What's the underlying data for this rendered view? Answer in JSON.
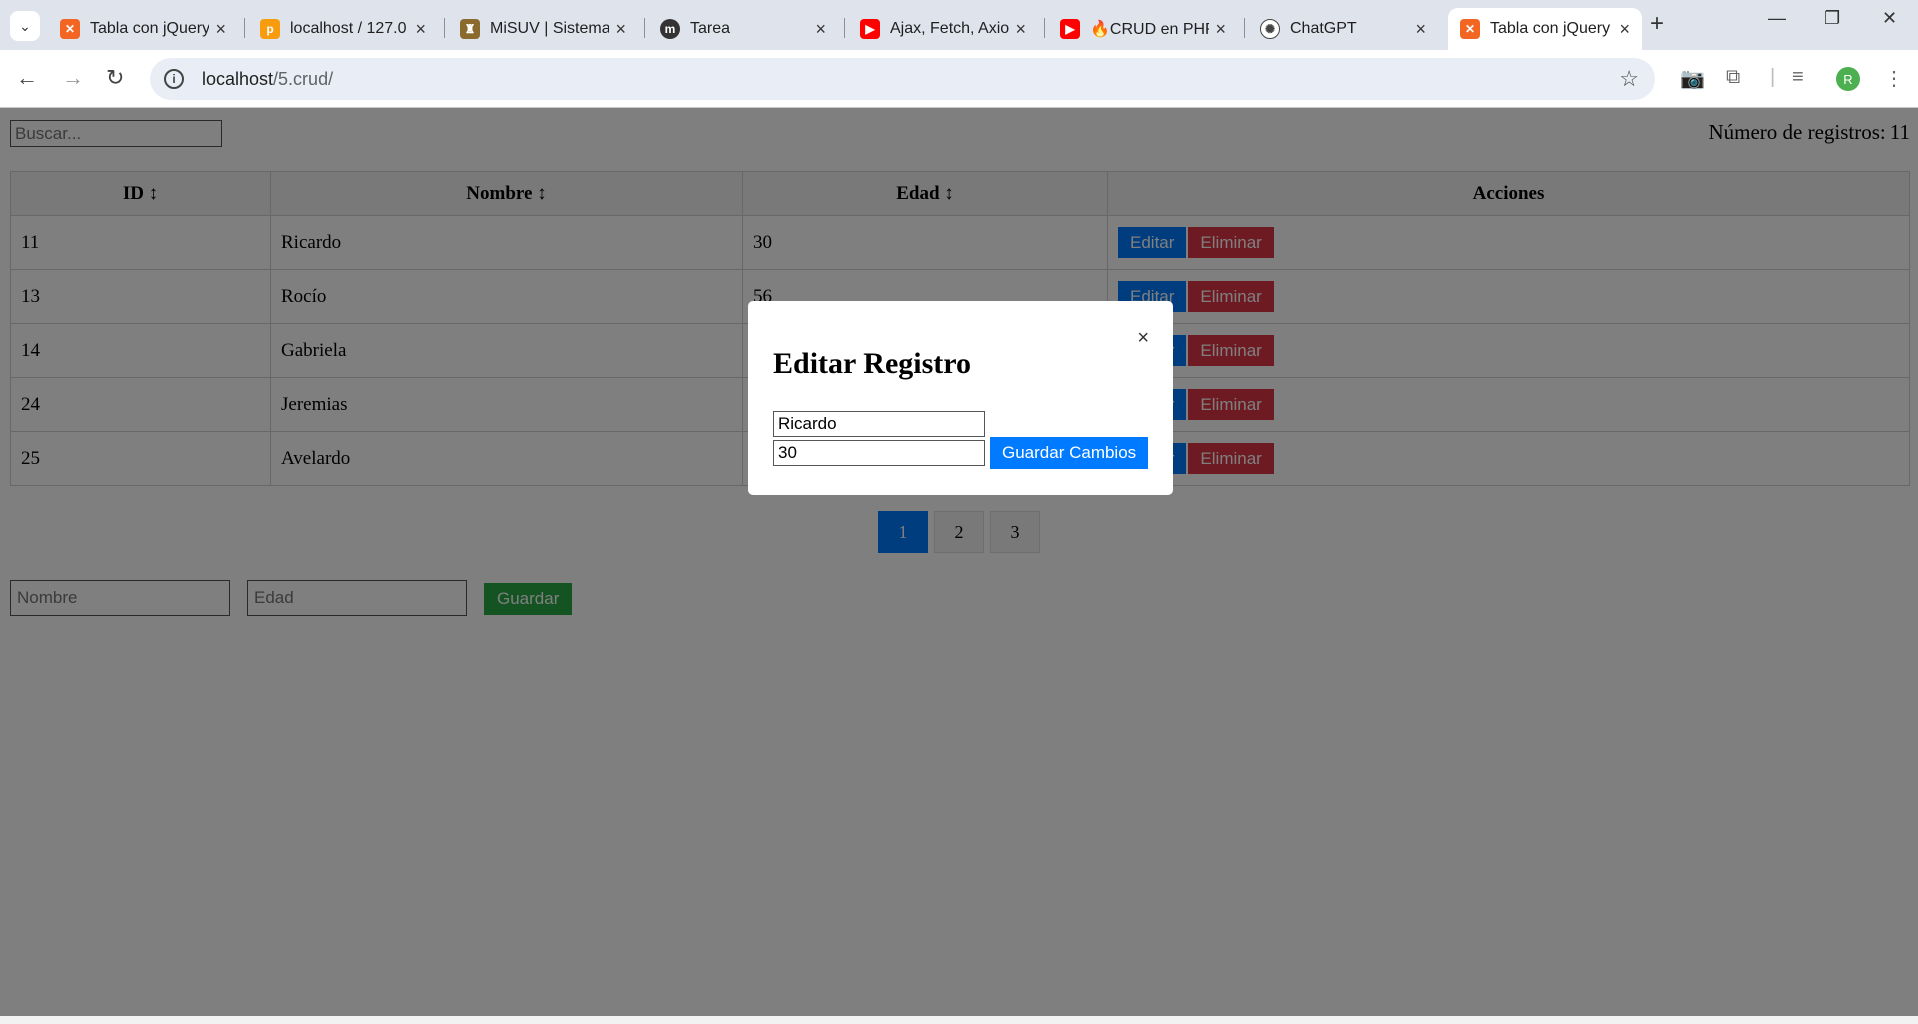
{
  "browser": {
    "tabs": [
      {
        "title": "Tabla con jQuery",
        "favicon": "xampp-icon",
        "color": "#f26522"
      },
      {
        "title": "localhost / 127.0",
        "favicon": "phpmyadmin-icon",
        "color": "#f89c0e"
      },
      {
        "title": "MiSUV | Sistema",
        "favicon": "uv-crest-icon",
        "color": "#8b6b2d"
      },
      {
        "title": "Tarea",
        "favicon": "moodle-icon",
        "color": "#333333"
      },
      {
        "title": "Ajax, Fetch, Axios",
        "favicon": "youtube-icon",
        "color": "#ff0000"
      },
      {
        "title": "🔥CRUD en PHP",
        "favicon": "youtube-icon",
        "color": "#ff0000"
      },
      {
        "title": "ChatGPT",
        "favicon": "openai-icon",
        "color": "#444444"
      },
      {
        "title": "Tabla con jQuery",
        "favicon": "xampp-icon",
        "color": "#f26522"
      }
    ],
    "url_host": "localhost",
    "url_path": "/5.crud/",
    "profile_initial": "R"
  },
  "page": {
    "search_placeholder": "Buscar...",
    "count_label": "Número de registros:",
    "count_value": "11",
    "table": {
      "headers": [
        "ID ↕",
        "Nombre ↕",
        "Edad ↕",
        "Acciones"
      ],
      "rows": [
        {
          "id": "11",
          "nombre": "Ricardo",
          "edad": "30"
        },
        {
          "id": "13",
          "nombre": "Rocío",
          "edad": "56"
        },
        {
          "id": "14",
          "nombre": "Gabriela",
          "edad": ""
        },
        {
          "id": "24",
          "nombre": "Jeremias",
          "edad": ""
        },
        {
          "id": "25",
          "nombre": "Avelardo",
          "edad": ""
        }
      ],
      "edit_label": "Editar",
      "delete_label": "Eliminar"
    },
    "pagination": [
      "1",
      "2",
      "3"
    ],
    "current_page": "1",
    "form": {
      "nombre_placeholder": "Nombre",
      "edad_placeholder": "Edad",
      "save_label": "Guardar"
    }
  },
  "modal": {
    "title": "Editar Registro",
    "close_label": "×",
    "nombre_value": "Ricardo",
    "edad_value": "30",
    "save_label": "Guardar Cambios"
  },
  "colors": {
    "primary": "#007bff",
    "danger": "#dc3545",
    "success": "#28a745"
  }
}
